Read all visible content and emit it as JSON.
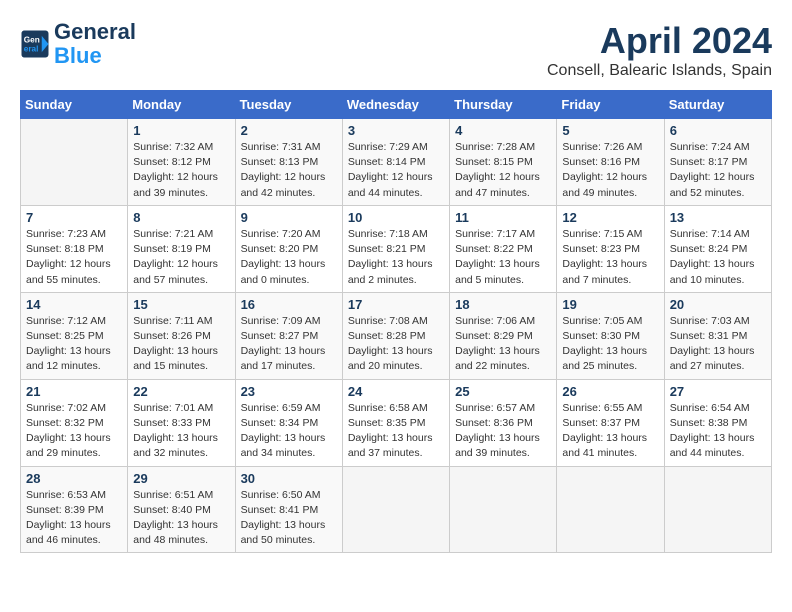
{
  "logo": {
    "line1": "General",
    "line2": "Blue"
  },
  "title": "April 2024",
  "location": "Consell, Balearic Islands, Spain",
  "days_header": [
    "Sunday",
    "Monday",
    "Tuesday",
    "Wednesday",
    "Thursday",
    "Friday",
    "Saturday"
  ],
  "weeks": [
    [
      {
        "day": "",
        "info": ""
      },
      {
        "day": "1",
        "info": "Sunrise: 7:32 AM\nSunset: 8:12 PM\nDaylight: 12 hours\nand 39 minutes."
      },
      {
        "day": "2",
        "info": "Sunrise: 7:31 AM\nSunset: 8:13 PM\nDaylight: 12 hours\nand 42 minutes."
      },
      {
        "day": "3",
        "info": "Sunrise: 7:29 AM\nSunset: 8:14 PM\nDaylight: 12 hours\nand 44 minutes."
      },
      {
        "day": "4",
        "info": "Sunrise: 7:28 AM\nSunset: 8:15 PM\nDaylight: 12 hours\nand 47 minutes."
      },
      {
        "day": "5",
        "info": "Sunrise: 7:26 AM\nSunset: 8:16 PM\nDaylight: 12 hours\nand 49 minutes."
      },
      {
        "day": "6",
        "info": "Sunrise: 7:24 AM\nSunset: 8:17 PM\nDaylight: 12 hours\nand 52 minutes."
      }
    ],
    [
      {
        "day": "7",
        "info": "Sunrise: 7:23 AM\nSunset: 8:18 PM\nDaylight: 12 hours\nand 55 minutes."
      },
      {
        "day": "8",
        "info": "Sunrise: 7:21 AM\nSunset: 8:19 PM\nDaylight: 12 hours\nand 57 minutes."
      },
      {
        "day": "9",
        "info": "Sunrise: 7:20 AM\nSunset: 8:20 PM\nDaylight: 13 hours\nand 0 minutes."
      },
      {
        "day": "10",
        "info": "Sunrise: 7:18 AM\nSunset: 8:21 PM\nDaylight: 13 hours\nand 2 minutes."
      },
      {
        "day": "11",
        "info": "Sunrise: 7:17 AM\nSunset: 8:22 PM\nDaylight: 13 hours\nand 5 minutes."
      },
      {
        "day": "12",
        "info": "Sunrise: 7:15 AM\nSunset: 8:23 PM\nDaylight: 13 hours\nand 7 minutes."
      },
      {
        "day": "13",
        "info": "Sunrise: 7:14 AM\nSunset: 8:24 PM\nDaylight: 13 hours\nand 10 minutes."
      }
    ],
    [
      {
        "day": "14",
        "info": "Sunrise: 7:12 AM\nSunset: 8:25 PM\nDaylight: 13 hours\nand 12 minutes."
      },
      {
        "day": "15",
        "info": "Sunrise: 7:11 AM\nSunset: 8:26 PM\nDaylight: 13 hours\nand 15 minutes."
      },
      {
        "day": "16",
        "info": "Sunrise: 7:09 AM\nSunset: 8:27 PM\nDaylight: 13 hours\nand 17 minutes."
      },
      {
        "day": "17",
        "info": "Sunrise: 7:08 AM\nSunset: 8:28 PM\nDaylight: 13 hours\nand 20 minutes."
      },
      {
        "day": "18",
        "info": "Sunrise: 7:06 AM\nSunset: 8:29 PM\nDaylight: 13 hours\nand 22 minutes."
      },
      {
        "day": "19",
        "info": "Sunrise: 7:05 AM\nSunset: 8:30 PM\nDaylight: 13 hours\nand 25 minutes."
      },
      {
        "day": "20",
        "info": "Sunrise: 7:03 AM\nSunset: 8:31 PM\nDaylight: 13 hours\nand 27 minutes."
      }
    ],
    [
      {
        "day": "21",
        "info": "Sunrise: 7:02 AM\nSunset: 8:32 PM\nDaylight: 13 hours\nand 29 minutes."
      },
      {
        "day": "22",
        "info": "Sunrise: 7:01 AM\nSunset: 8:33 PM\nDaylight: 13 hours\nand 32 minutes."
      },
      {
        "day": "23",
        "info": "Sunrise: 6:59 AM\nSunset: 8:34 PM\nDaylight: 13 hours\nand 34 minutes."
      },
      {
        "day": "24",
        "info": "Sunrise: 6:58 AM\nSunset: 8:35 PM\nDaylight: 13 hours\nand 37 minutes."
      },
      {
        "day": "25",
        "info": "Sunrise: 6:57 AM\nSunset: 8:36 PM\nDaylight: 13 hours\nand 39 minutes."
      },
      {
        "day": "26",
        "info": "Sunrise: 6:55 AM\nSunset: 8:37 PM\nDaylight: 13 hours\nand 41 minutes."
      },
      {
        "day": "27",
        "info": "Sunrise: 6:54 AM\nSunset: 8:38 PM\nDaylight: 13 hours\nand 44 minutes."
      }
    ],
    [
      {
        "day": "28",
        "info": "Sunrise: 6:53 AM\nSunset: 8:39 PM\nDaylight: 13 hours\nand 46 minutes."
      },
      {
        "day": "29",
        "info": "Sunrise: 6:51 AM\nSunset: 8:40 PM\nDaylight: 13 hours\nand 48 minutes."
      },
      {
        "day": "30",
        "info": "Sunrise: 6:50 AM\nSunset: 8:41 PM\nDaylight: 13 hours\nand 50 minutes."
      },
      {
        "day": "",
        "info": ""
      },
      {
        "day": "",
        "info": ""
      },
      {
        "day": "",
        "info": ""
      },
      {
        "day": "",
        "info": ""
      }
    ]
  ]
}
